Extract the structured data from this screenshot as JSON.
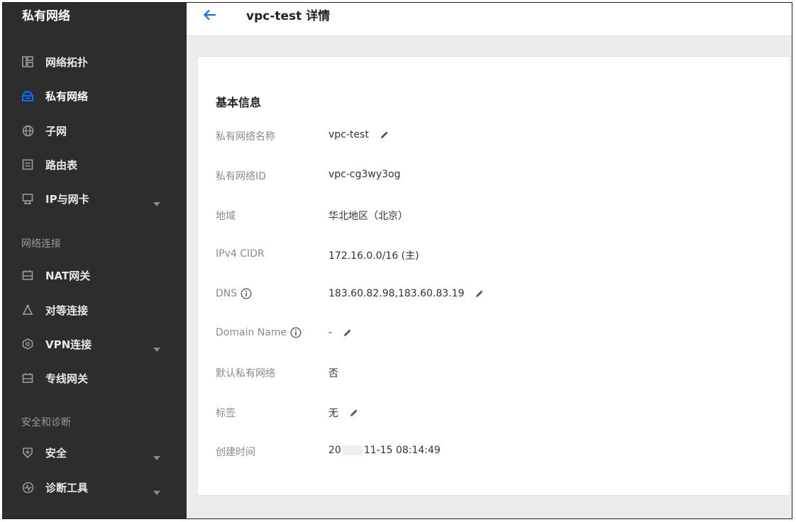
{
  "sidebar": {
    "title": "私有网络",
    "items": [
      {
        "label": "网络拓扑",
        "icon": "topology-icon",
        "active": false
      },
      {
        "label": "私有网络",
        "icon": "cloud-network-icon",
        "active": true
      },
      {
        "label": "子网",
        "icon": "globe-icon",
        "active": false
      },
      {
        "label": "路由表",
        "icon": "route-table-icon",
        "active": false
      },
      {
        "label": "IP与网卡",
        "icon": "network-card-icon",
        "active": false,
        "expandable": true
      }
    ],
    "group_network": "网络连接",
    "items_network": [
      {
        "label": "NAT网关",
        "icon": "gateway-icon"
      },
      {
        "label": "对等连接",
        "icon": "peering-icon"
      },
      {
        "label": "VPN连接",
        "icon": "vpn-icon",
        "expandable": true
      },
      {
        "label": "专线网关",
        "icon": "gateway-icon"
      }
    ],
    "group_security": "安全和诊断",
    "items_security": [
      {
        "label": "安全",
        "icon": "shield-icon",
        "expandable": true
      },
      {
        "label": "诊断工具",
        "icon": "diagnosis-icon",
        "expandable": true
      }
    ]
  },
  "header": {
    "title": "vpc-test 详情"
  },
  "details": {
    "section_title": "基本信息",
    "rows": [
      {
        "label": "私有网络名称",
        "value": "vpc-test",
        "editable": true
      },
      {
        "label": "私有网络ID",
        "value": "vpc-cg3wy3og"
      },
      {
        "label": "地域",
        "value": "华北地区（北京）"
      },
      {
        "label": "IPv4 CIDR",
        "value": "172.16.0.0/16 (主)"
      },
      {
        "label": "DNS",
        "value": "183.60.82.98,183.60.83.19",
        "editable": true,
        "info": true
      },
      {
        "label": "Domain Name",
        "value": "-",
        "editable": true,
        "info": true
      },
      {
        "label": "默认私有网络",
        "value": "否"
      },
      {
        "label": "标签",
        "value": "无",
        "editable": true
      },
      {
        "label": "创建时间",
        "value_prefix": "20",
        "value_suffix": "11-15 08:14:49"
      }
    ]
  },
  "colors": {
    "sidebar_bg": "#2d2d2d",
    "accent": "#006eff",
    "page_bg": "#ececec"
  }
}
